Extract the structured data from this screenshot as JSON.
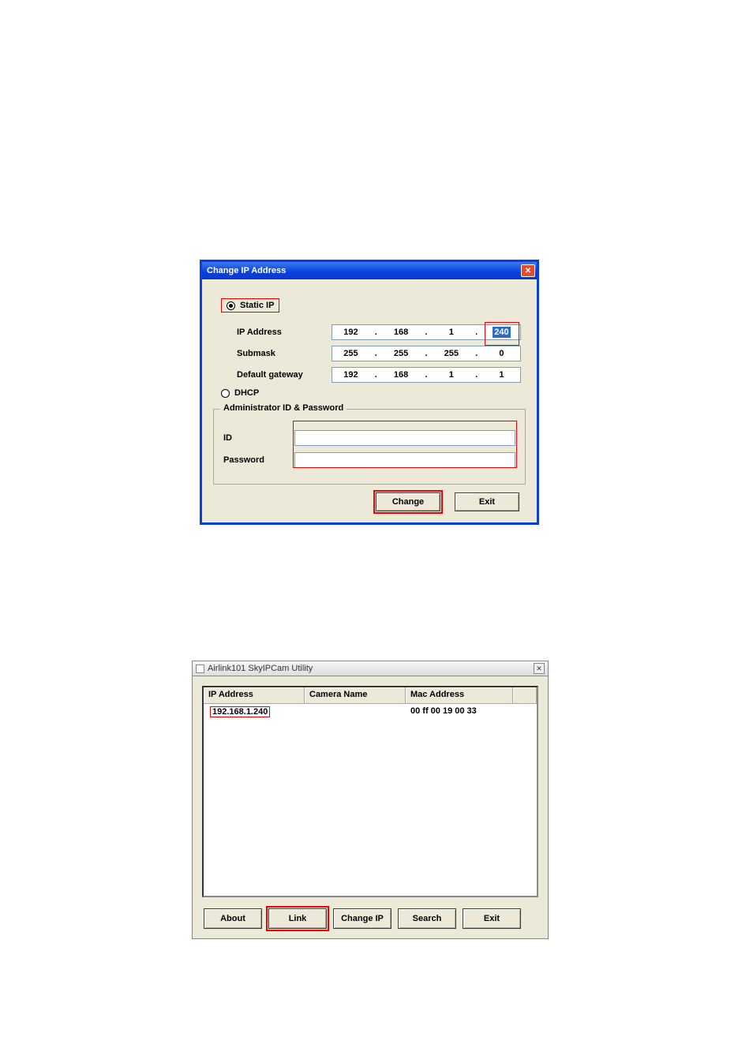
{
  "dlg1": {
    "title": "Change IP Address",
    "radio_static": "Static IP",
    "radio_dhcp": "DHCP",
    "row_ip_label": "IP Address",
    "row_sub_label": "Submask",
    "row_gw_label": "Default gateway",
    "ip": {
      "o1": "192",
      "o2": "168",
      "o3": "1",
      "o4": "240"
    },
    "sub": {
      "o1": "255",
      "o2": "255",
      "o3": "255",
      "o4": "0"
    },
    "gw": {
      "o1": "192",
      "o2": "168",
      "o3": "1",
      "o4": "1"
    },
    "group_admin": "Administrator ID & Password",
    "id_label": "ID",
    "pw_label": "Password",
    "btn_change": "Change",
    "btn_exit": "Exit"
  },
  "dlg2": {
    "title": "Airlink101 SkyIPCam Utility",
    "col_ip": "IP Address",
    "col_name": "Camera Name",
    "col_mac": "Mac Address",
    "row0_ip": "192.168.1.240",
    "row0_name": "",
    "row0_mac": "00 ff 00 19 00 33",
    "btn_about": "About",
    "btn_link": "Link",
    "btn_changeip": "Change IP",
    "btn_search": "Search",
    "btn_exit": "Exit"
  }
}
